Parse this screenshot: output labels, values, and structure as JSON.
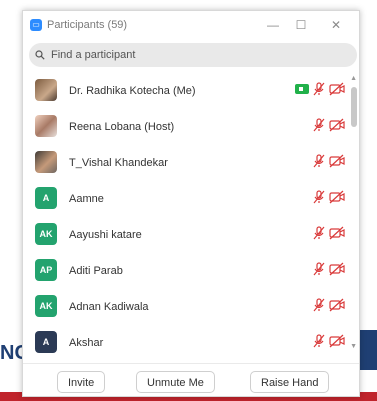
{
  "background": {
    "text": "NC"
  },
  "window": {
    "title": "Participants (59)",
    "app_icon": "zoom-icon",
    "controls": {
      "minimize": "—",
      "maximize": "☐",
      "close": "✕"
    }
  },
  "search": {
    "placeholder": "Find a participant"
  },
  "participants": [
    {
      "name": "Dr. Radhika Kotecha (Me)",
      "initials": "",
      "avatar_type": "photo",
      "video_on": true
    },
    {
      "name": "Reena Lobana (Host)",
      "initials": "",
      "avatar_type": "photo2",
      "video_on": false
    },
    {
      "name": "T_Vishal Khandekar",
      "initials": "",
      "avatar_type": "photo3",
      "video_on": false
    },
    {
      "name": "Aamne",
      "initials": "A",
      "color": "#23a36e",
      "video_on": false
    },
    {
      "name": "Aayushi katare",
      "initials": "AK",
      "color": "#23a36e",
      "video_on": false
    },
    {
      "name": "Aditi Parab",
      "initials": "AP",
      "color": "#23a36e",
      "video_on": false
    },
    {
      "name": "Adnan Kadiwala",
      "initials": "AK",
      "color": "#23a36e",
      "video_on": false
    },
    {
      "name": "Akshar",
      "initials": "A",
      "color": "#2b3a55",
      "video_on": false
    }
  ],
  "footer": {
    "invite": "Invite",
    "unmute": "Unmute Me",
    "raise_hand": "Raise Hand"
  },
  "colors": {
    "muted_red": "#d93a3a",
    "video_green": "#21b14a"
  }
}
